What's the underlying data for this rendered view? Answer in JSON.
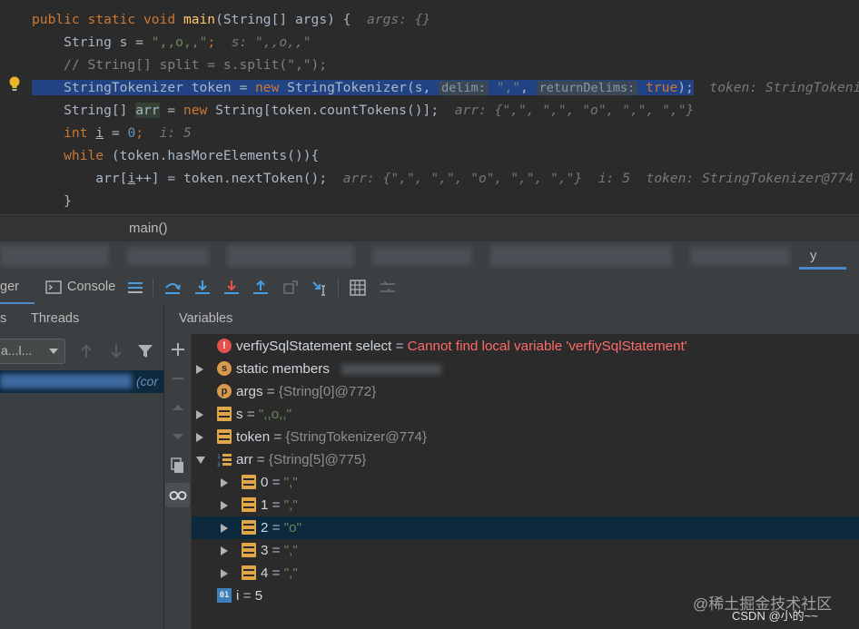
{
  "editor": {
    "lines": [
      {
        "p1": "public static void ",
        "fn": "main",
        "p2": "(String[] args) {  ",
        "hint": "args: {}"
      },
      {
        "a": "    String s = ",
        "str": "\",,o,,\"",
        "b": ";  ",
        "hint": "s: \",,o,,\""
      },
      {
        "cmt": "    // String[] split = s.split(\",\");"
      },
      {
        "a": "    StringTokenizer token = ",
        "kw": "new",
        "b": " StringTokenizer(s, ",
        "h1": "delim:",
        "s1": "\",\"",
        "c": ", ",
        "h2": "returnDelims:",
        "kw2": "true",
        "d": ");",
        "hint": "token: StringTokenizer@774"
      },
      {
        "a": "    String[] ",
        "var": "arr",
        "b": " = ",
        "kw": "new",
        "c": " String[token.countTokens()];  ",
        "hint": "arr: {\",\", \",\", \"o\", \",\", \",\"}"
      },
      {
        "kw": "    int ",
        "var": "i",
        "b": " = ",
        "num": "0",
        "c": ";  ",
        "hint": "i: 5"
      },
      {
        "kw": "    while",
        "a": " (token.hasMoreElements()){"
      },
      {
        "a": "        arr[",
        "var": "i",
        "b": "++] = token.nextToken();  ",
        "hint": "arr: {\",\", \",\", \"o\", \",\", \",\"}  i: 5  token: StringTokenizer@774"
      },
      {
        "a": "    }"
      }
    ]
  },
  "method_bar": {
    "label": "main()"
  },
  "tabs_row": {
    "visible_label": "y"
  },
  "debugger_toolbar": {
    "debugger_label": "ger",
    "console_label": "Console"
  },
  "sub_header": {
    "frames_label": "s",
    "threads_label": "Threads",
    "variables_label": "Variables"
  },
  "left_panel": {
    "thread_select": "a...l...",
    "frame_text": "(cor"
  },
  "variables": [
    {
      "icon": "error",
      "name": "verfiySqlStatement select",
      "eq": " = ",
      "value": "Cannot find local variable 'verfiySqlStatement'",
      "style": "error",
      "expand": "none",
      "indent": 0
    },
    {
      "icon": "static",
      "name": "static members",
      "eq": "",
      "value": "",
      "style": "plain",
      "expand": "right",
      "indent": 0
    },
    {
      "icon": "param",
      "name": "args",
      "eq": " = ",
      "value": "{String[0]@772}",
      "style": "obj",
      "expand": "none",
      "indent": 0
    },
    {
      "icon": "field",
      "name": "s",
      "eq": " = ",
      "value": "\",,o,,\"",
      "style": "str",
      "expand": "right",
      "indent": 0
    },
    {
      "icon": "field",
      "name": "token",
      "eq": " = ",
      "value": "{StringTokenizer@774}",
      "style": "obj",
      "expand": "right",
      "indent": 0
    },
    {
      "icon": "array",
      "name": "arr",
      "eq": " = ",
      "value": "{String[5]@775}",
      "style": "obj",
      "expand": "down",
      "indent": 0
    },
    {
      "icon": "field",
      "name": "0",
      "eq": " = ",
      "value": "\",\"",
      "style": "str",
      "expand": "right",
      "indent": 1
    },
    {
      "icon": "field",
      "name": "1",
      "eq": " = ",
      "value": "\",\"",
      "style": "str",
      "expand": "right",
      "indent": 1
    },
    {
      "icon": "field",
      "name": "2",
      "eq": " = ",
      "value": "\"o\"",
      "style": "str",
      "expand": "right",
      "indent": 1,
      "selected": true
    },
    {
      "icon": "field",
      "name": "3",
      "eq": " = ",
      "value": "\",\"",
      "style": "str",
      "expand": "right",
      "indent": 1
    },
    {
      "icon": "field",
      "name": "4",
      "eq": " = ",
      "value": "\",\"",
      "style": "str",
      "expand": "right",
      "indent": 1
    },
    {
      "icon": "int",
      "name": "i",
      "eq": " = ",
      "value": "5",
      "style": "plain",
      "expand": "none",
      "indent": 0
    }
  ],
  "watermark": {
    "line1": "@稀土掘金技术社区",
    "line2": "CSDN @小的~~"
  },
  "colors": {
    "bg": "#2b2b2b",
    "panel": "#3c3f41",
    "selection": "#214283",
    "row_selected": "#0d293e",
    "keyword": "#cc7832",
    "string": "#6a8759",
    "number": "#6897bb",
    "error": "#ff6b68"
  }
}
